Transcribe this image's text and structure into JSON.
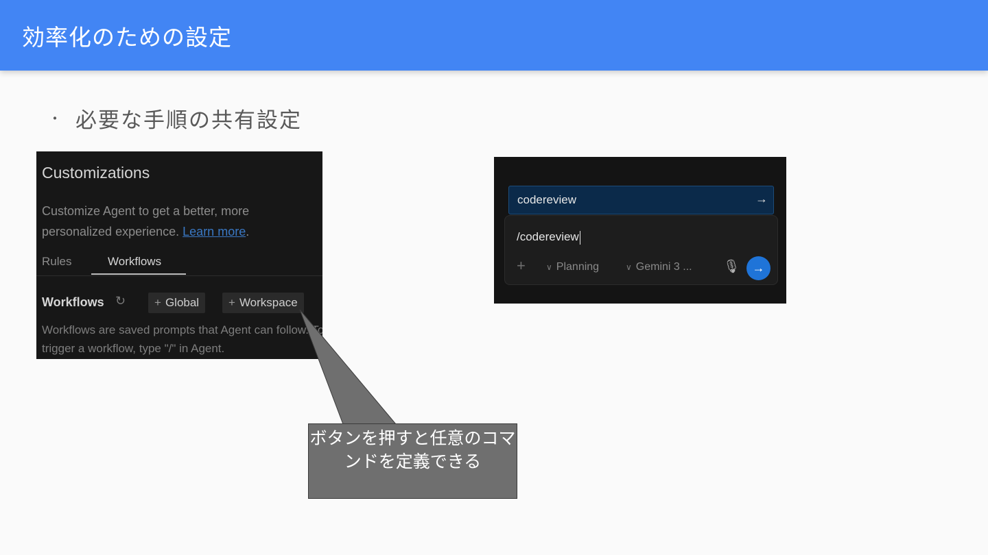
{
  "header": {
    "title": "効率化のための設定"
  },
  "bullet": {
    "marker": "・",
    "text": "必要な手順の共有設定"
  },
  "customizations": {
    "title": "Customizations",
    "description": "Customize Agent to get a better, more personalized experience.",
    "learn_more": "Learn more",
    "period": ".",
    "tabs": [
      {
        "label": "Rules"
      },
      {
        "label": "Workflows"
      }
    ],
    "section_label": "Workflows",
    "global_button": "Global",
    "workspace_button": "Workspace",
    "plus": "+",
    "footer_text": "Workflows are saved prompts that Agent can follow. To trigger a workflow, type \"/\" in Agent."
  },
  "agent_panel": {
    "suggestion": "codereview",
    "input_value": "/codereview",
    "mode": "Planning",
    "model": "Gemini 3 ..."
  },
  "callout": {
    "text": "ボタンを押すと任意のコマンドを定義できる"
  },
  "colors": {
    "header": "#4285f4",
    "send_button": "#1f74d8",
    "callout": "#6f6f6f"
  }
}
